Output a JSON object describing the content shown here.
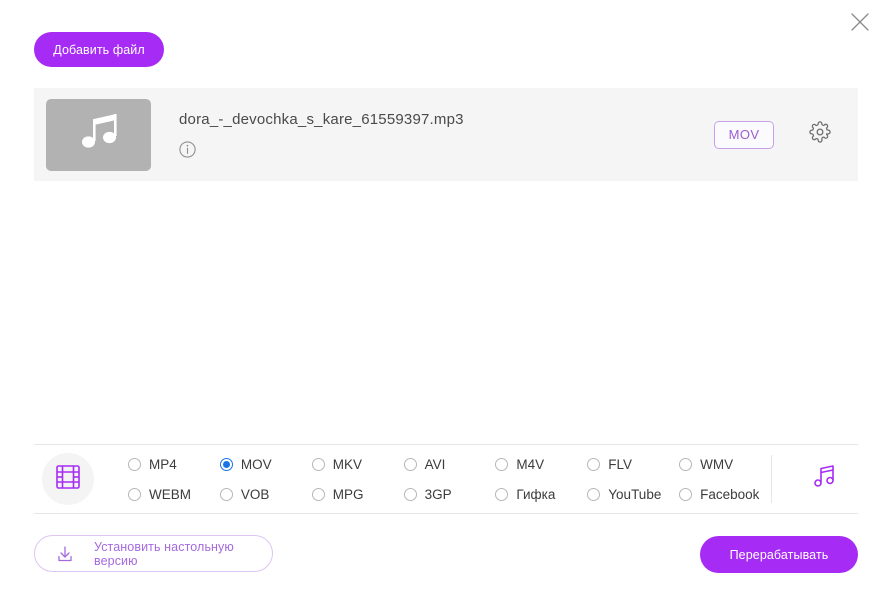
{
  "window": {
    "close_label": "✕"
  },
  "toolbar": {
    "add_file_label": "Добавить файл"
  },
  "file": {
    "name": "dora_-_devochka_s_kare_61559397.mp3",
    "target_format": "MOV",
    "thumbnail_icon": "music-note-icon",
    "info_icon": "info-icon",
    "settings_icon": "gear-icon"
  },
  "format_panel": {
    "media_type_icon": "film-strip-icon",
    "audio_icon": "music-note-icon",
    "selected": "MOV",
    "options": [
      {
        "label": "MP4",
        "selected": false
      },
      {
        "label": "MOV",
        "selected": true
      },
      {
        "label": "MKV",
        "selected": false
      },
      {
        "label": "AVI",
        "selected": false
      },
      {
        "label": "M4V",
        "selected": false
      },
      {
        "label": "FLV",
        "selected": false
      },
      {
        "label": "WMV",
        "selected": false
      },
      {
        "label": "WEBM",
        "selected": false
      },
      {
        "label": "VOB",
        "selected": false
      },
      {
        "label": "MPG",
        "selected": false
      },
      {
        "label": "3GP",
        "selected": false
      },
      {
        "label": "Гифка",
        "selected": false
      },
      {
        "label": "YouTube",
        "selected": false
      },
      {
        "label": "Facebook",
        "selected": false
      }
    ]
  },
  "footer": {
    "desktop_label": "Установить настольную версию",
    "desktop_icon": "download-icon",
    "convert_label": "Перерабатывать"
  },
  "colors": {
    "accent_purple": "#a62cf5",
    "badge_purple": "#9b5fd0",
    "radio_blue": "#1a73e8",
    "row_bg": "#f5f5f5",
    "thumb_bg": "#b2b2b2"
  }
}
